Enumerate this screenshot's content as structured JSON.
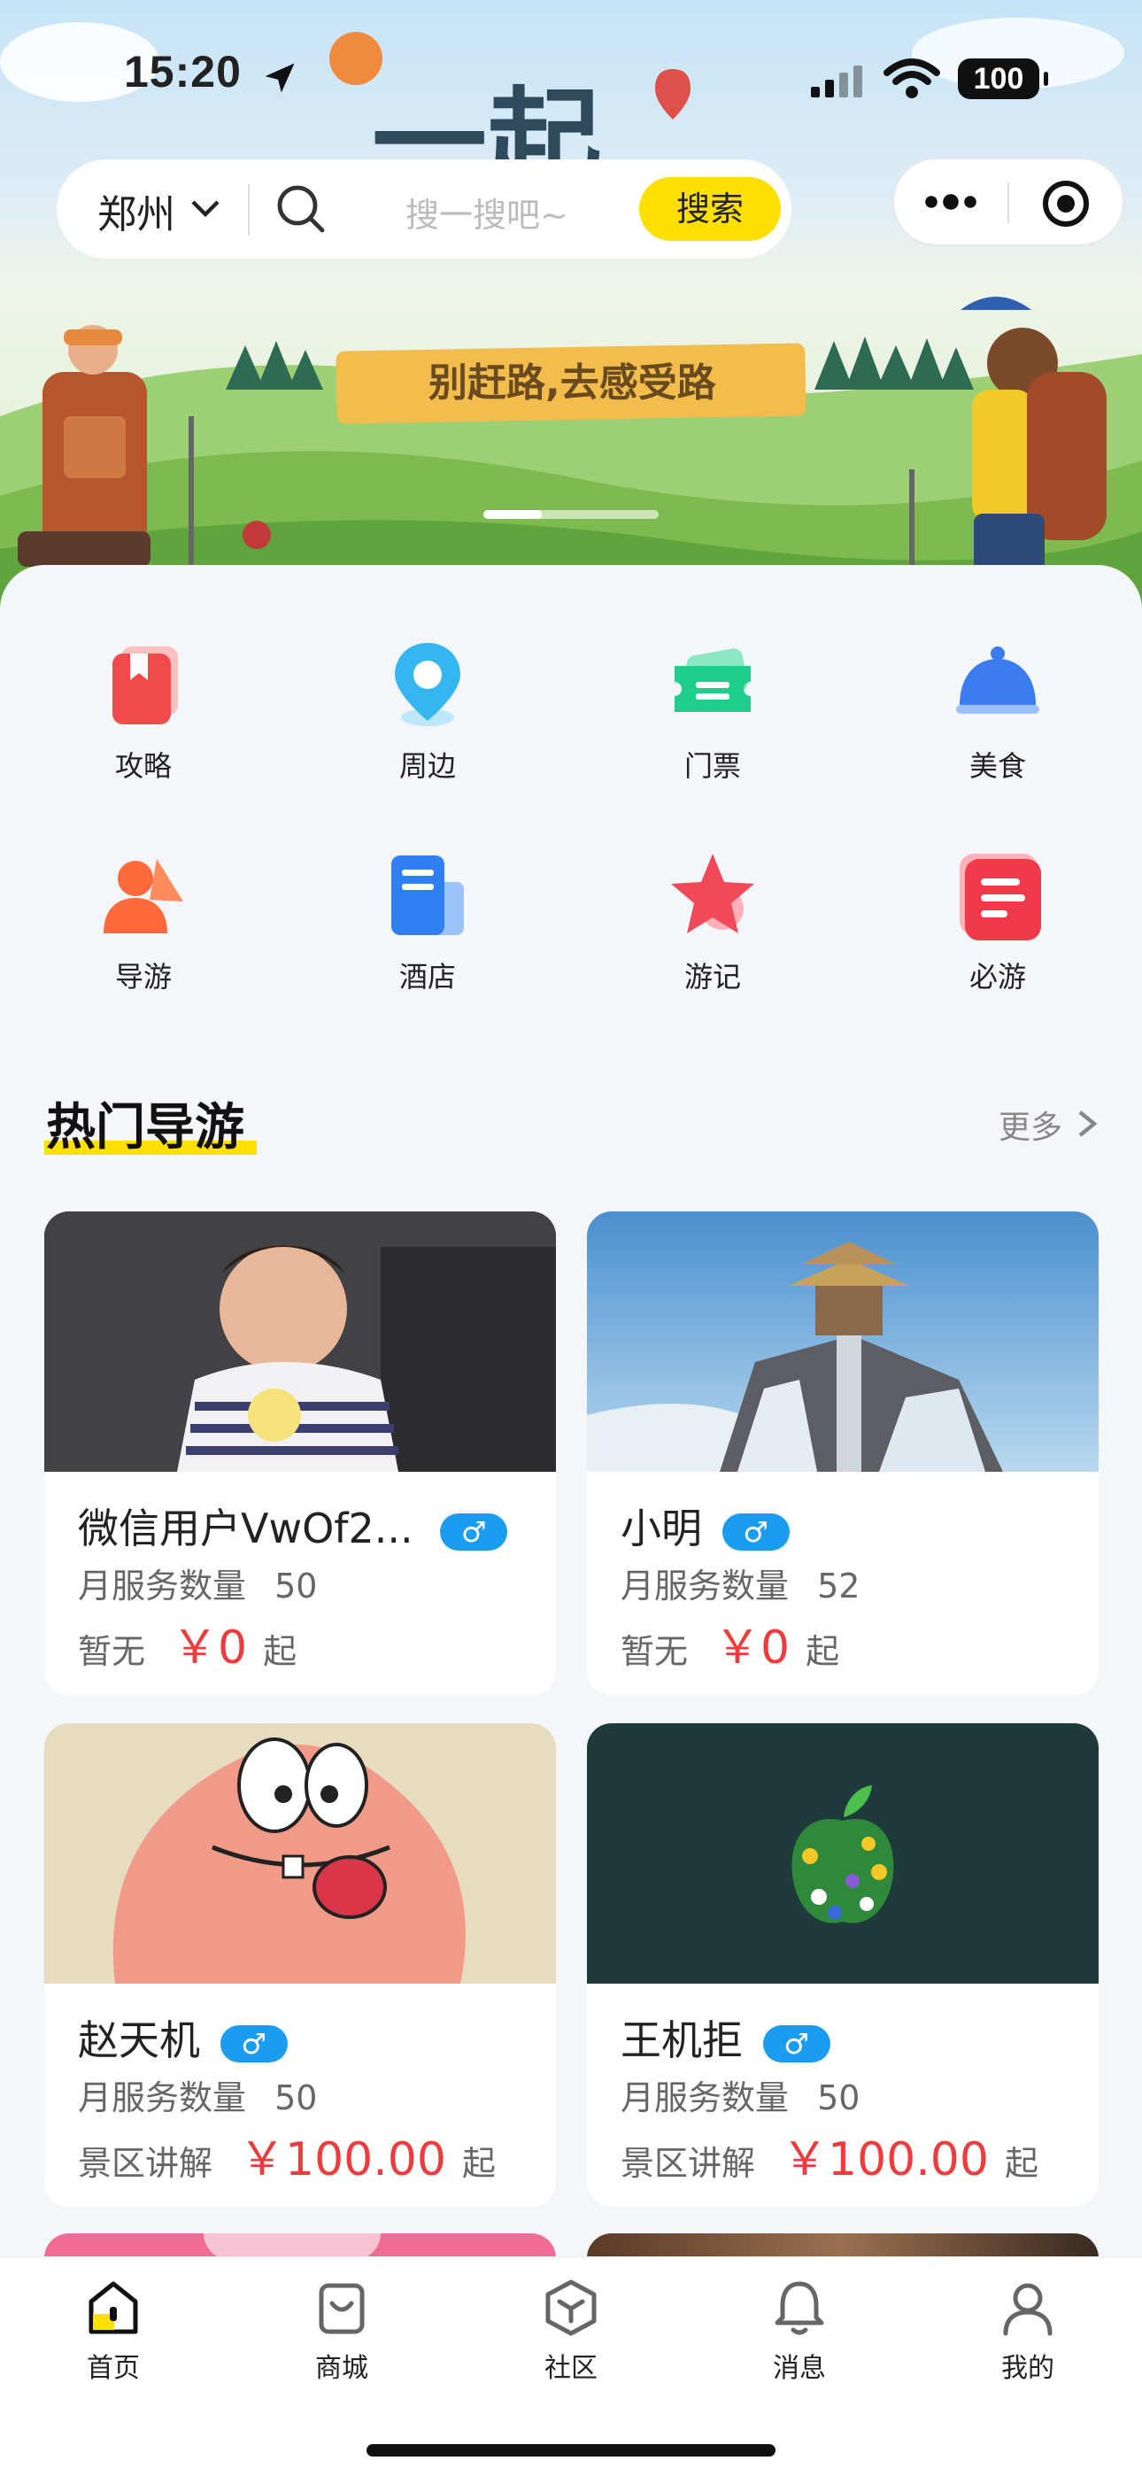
{
  "status_bar": {
    "time": "15:20",
    "battery": "100"
  },
  "header": {
    "location": "郑州",
    "search_placeholder": "搜一搜吧~",
    "search_button": "搜索"
  },
  "banner": {
    "headline": "一起",
    "slogan": "别赶路,去感受路",
    "slides_active": 1,
    "slides_total": 3
  },
  "categories": [
    {
      "label": "攻略",
      "icon": "bookmark-book-icon",
      "color": "#f04a4a"
    },
    {
      "label": "周边",
      "icon": "map-pin-icon",
      "color": "#34b7f1"
    },
    {
      "label": "门票",
      "icon": "ticket-icon",
      "color": "#1ecf8c"
    },
    {
      "label": "美食",
      "icon": "food-cloche-icon",
      "color": "#3b7cf0"
    },
    {
      "label": "导游",
      "icon": "guide-person-icon",
      "color": "#ff6a3d"
    },
    {
      "label": "酒店",
      "icon": "hotel-building-icon",
      "color": "#2f7ef2"
    },
    {
      "label": "游记",
      "icon": "star-icon",
      "color": "#f04a5a"
    },
    {
      "label": "必游",
      "icon": "list-card-icon",
      "color": "#f03a4a"
    }
  ],
  "section": {
    "title": "热门导游",
    "more": "更多"
  },
  "guides": [
    {
      "name": "微信用户VwOf2...",
      "gender": "♂",
      "service_label": "月服务数量",
      "service_count": "50",
      "tag": "暂无",
      "price": "￥0",
      "suffix": "起"
    },
    {
      "name": "小明",
      "gender": "♂",
      "service_label": "月服务数量",
      "service_count": "52",
      "tag": "暂无",
      "price": "￥0",
      "suffix": "起"
    },
    {
      "name": "赵天机",
      "gender": "♂",
      "service_label": "月服务数量",
      "service_count": "50",
      "tag": "景区讲解",
      "price": "￥100.00",
      "suffix": "起"
    },
    {
      "name": "王机拒",
      "gender": "♂",
      "service_label": "月服务数量",
      "service_count": "50",
      "tag": "景区讲解",
      "price": "￥100.00",
      "suffix": "起"
    }
  ],
  "tabbar": [
    {
      "label": "首页",
      "icon": "home-icon",
      "active": true
    },
    {
      "label": "商城",
      "icon": "shopping-bag-icon",
      "active": false
    },
    {
      "label": "社区",
      "icon": "cube-community-icon",
      "active": false
    },
    {
      "label": "消息",
      "icon": "bell-icon",
      "active": false
    },
    {
      "label": "我的",
      "icon": "user-icon",
      "active": false
    }
  ],
  "colors": {
    "accent": "#fde001",
    "price": "#ef3b3b",
    "gender_badge": "#1a9dee",
    "background": "#f4f6fa"
  }
}
